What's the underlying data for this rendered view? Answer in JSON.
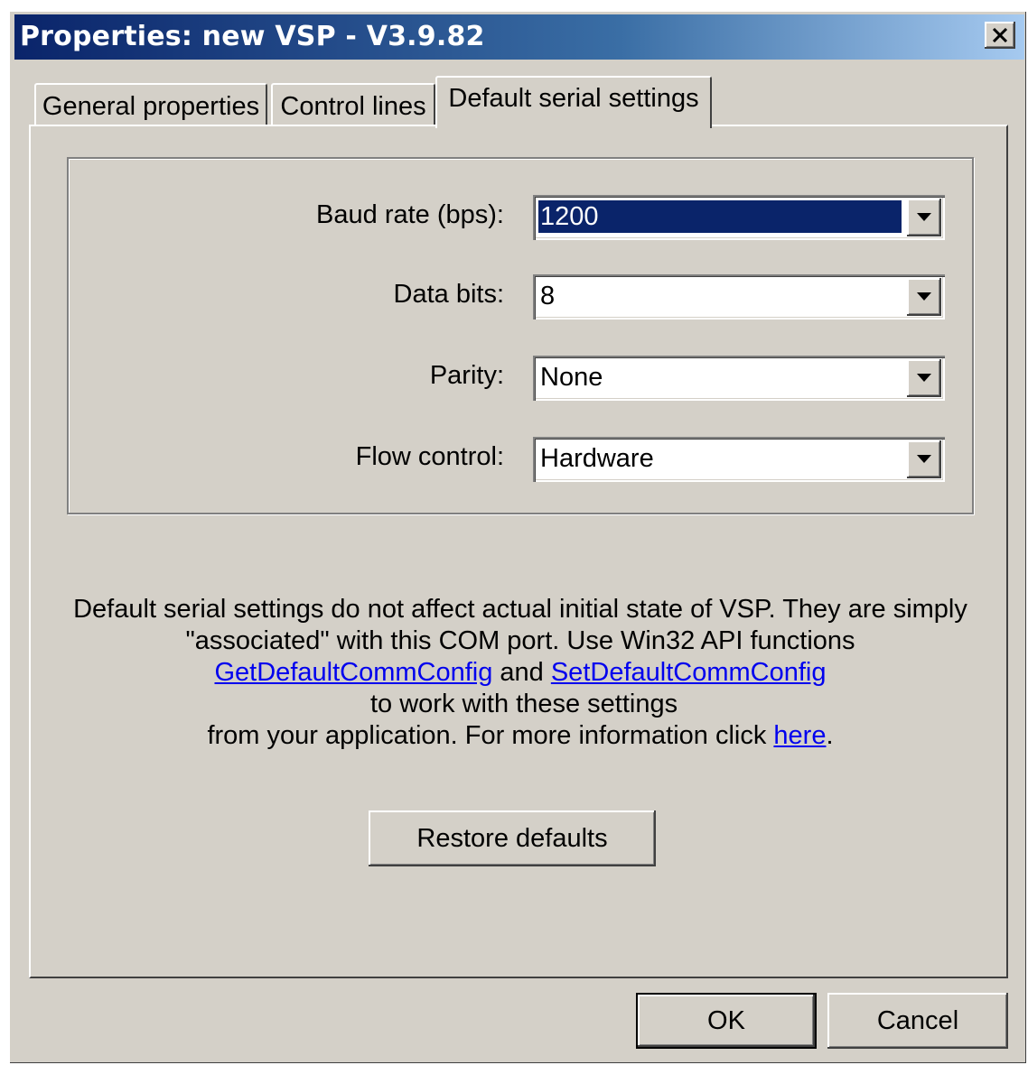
{
  "window": {
    "title": "Properties: new VSP - V3.9.82",
    "close_icon": "close-icon"
  },
  "tabs": [
    {
      "label": "General properties",
      "active": false
    },
    {
      "label": "Control lines",
      "active": false
    },
    {
      "label": "Default serial settings",
      "active": true
    }
  ],
  "settings": {
    "baud_rate": {
      "label": "Baud rate (bps):",
      "value": "1200"
    },
    "data_bits": {
      "label": "Data bits:",
      "value": "8"
    },
    "parity": {
      "label": "Parity:",
      "value": "None"
    },
    "flow_control": {
      "label": "Flow control:",
      "value": "Hardware"
    }
  },
  "info": {
    "line1": "Default serial settings do not affect actual initial state of VSP. They are simply",
    "line2": "\"associated\" with this COM port. Use Win32 API functions",
    "link_get": "GetDefaultCommConfig",
    "and_text": " and ",
    "link_set": "SetDefaultCommConfig",
    "after_links": " to work with these settings",
    "line4_prefix": "from your application. For more information click ",
    "link_here": "here",
    "line4_suffix": "."
  },
  "buttons": {
    "restore": "Restore defaults",
    "ok": "OK",
    "cancel": "Cancel"
  },
  "colors": {
    "dialog_bg": "#d4d0c8",
    "titlebar_start": "#0a246a",
    "titlebar_end": "#a6caf0",
    "selection": "#0a246a",
    "link": "#0000ee"
  }
}
